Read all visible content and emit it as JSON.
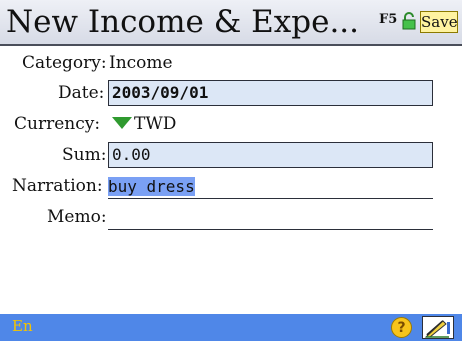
{
  "header": {
    "title": "New Income & Expe...",
    "f5_label": "F5",
    "save_label": "Save"
  },
  "form": {
    "category": {
      "label": "Category:",
      "value": "Income"
    },
    "date": {
      "label": "Date:",
      "value": "2003/09/01"
    },
    "currency": {
      "label": "Currency:",
      "value": "TWD"
    },
    "sum": {
      "label": "Sum:",
      "value": "0.00"
    },
    "narration": {
      "label": "Narration:",
      "value": "buy dress"
    },
    "memo": {
      "label": "Memo:",
      "value": ""
    }
  },
  "footer": {
    "input_mode": "En",
    "help_label": "?"
  },
  "colors": {
    "field_bg": "#dce7f6",
    "selection": "#7aa0f4",
    "bottombar": "#4f87e8",
    "save_bg": "#fff3a0"
  }
}
